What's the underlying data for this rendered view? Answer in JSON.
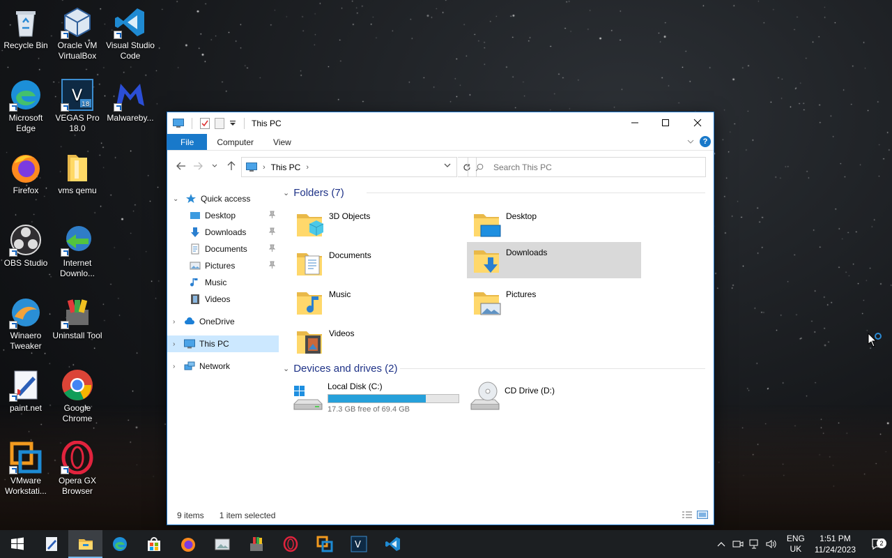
{
  "desktop": {
    "icons": [
      {
        "label": "Recycle Bin"
      },
      {
        "label": "Oracle VM VirtualBox"
      },
      {
        "label": "Visual Studio Code"
      },
      {
        "label": "Microsoft Edge"
      },
      {
        "label": "VEGAS Pro 18.0"
      },
      {
        "label": "Malwareby..."
      },
      {
        "label": "Firefox"
      },
      {
        "label": "vms qemu"
      },
      {
        "label": "OBS Studio"
      },
      {
        "label": "Internet Downlo..."
      },
      {
        "label": "Winaero Tweaker"
      },
      {
        "label": "Uninstall Tool"
      },
      {
        "label": "paint.net"
      },
      {
        "label": "Google Chrome"
      },
      {
        "label": "VMware Workstati..."
      },
      {
        "label": "Opera GX Browser"
      }
    ],
    "vegas_badge": "18"
  },
  "window": {
    "title": "This PC",
    "ribbon_tabs": [
      "File",
      "Computer",
      "View"
    ],
    "help": "?",
    "address": {
      "location": "This PC"
    },
    "search": {
      "placeholder": "Search This PC"
    },
    "nav_pane": {
      "quick_access": "Quick access",
      "quick_items": [
        "Desktop",
        "Downloads",
        "Documents",
        "Pictures",
        "Music",
        "Videos"
      ],
      "onedrive": "OneDrive",
      "this_pc": "This PC",
      "network": "Network"
    },
    "folders_header": "Folders (7)",
    "folders": [
      "3D Objects",
      "Desktop",
      "Documents",
      "Downloads",
      "Music",
      "Pictures",
      "Videos"
    ],
    "devices_header": "Devices and drives (2)",
    "drives": [
      {
        "name": "Local Disk (C:)",
        "free": "17.3 GB free of 69.4 GB",
        "used_fraction": 0.75
      },
      {
        "name": "CD Drive (D:)"
      }
    ],
    "status": {
      "items": "9 items",
      "selected": "1 item selected"
    }
  },
  "taskbar": {
    "lang_top": "ENG",
    "lang_bottom": "UK",
    "time": "1:51 PM",
    "date": "11/24/2023",
    "notifications": "2",
    "colors": {
      "accent": "#1979ca",
      "taskbar": "#1c1f22",
      "selection": "#cce8ff"
    }
  }
}
